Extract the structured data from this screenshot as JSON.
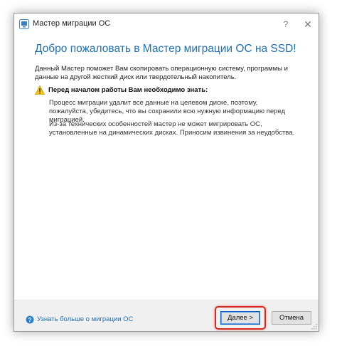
{
  "window": {
    "title": "Мастер миграции ОС",
    "help_label": "?",
    "close_label": "✕"
  },
  "heading": "Добро пожаловать в Мастер миграции ОС на SSD!",
  "intro": "Данный Мастер поможет Вам скопировать операционную систему, программы и данные на другой жесткий диск или твердотельный накопитель.",
  "warning": {
    "icon": "warning-icon",
    "title": "Перед началом работы Вам необходимо знать:",
    "paragraphs": [
      "Процесс миграции удалит все данные на целевом диске, поэтому, пожалуйста, убедитесь, что вы сохранили всю нужную информацию перед миграцией.",
      "Из-за технических особенностей мастер не может мигрировать ОС, установленные на динамических дисках. Приносим извинения за неудобства."
    ]
  },
  "footer": {
    "learn_more": "Узнать больше о миграции ОС",
    "next_label": "Далее >",
    "cancel_label": "Отмена"
  },
  "colors": {
    "accent": "#1f6fb5",
    "highlight": "#d42a1f",
    "footer_bg": "#f0f0f0"
  }
}
